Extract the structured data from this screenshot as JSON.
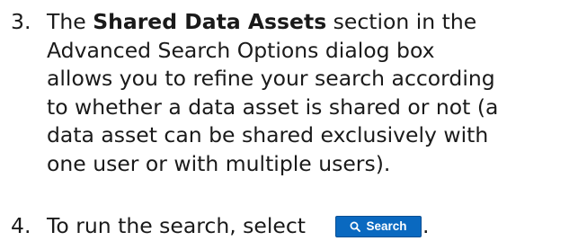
{
  "steps": [
    {
      "number": "3.",
      "intro": "The ",
      "bold": "Shared Data Assets",
      "line1_rest": " section in the",
      "line2": "Advanced Search Options dialog box",
      "line3": "allows you to refine your search according",
      "line4": "to whether a data asset is shared or not (a",
      "line5": "data asset can be shared exclusively with",
      "line6": "one user or with multiple users)."
    },
    {
      "number": "4.",
      "text": "To run the search, select",
      "button_label": "Search",
      "button_icon": "search-icon",
      "suffix": "."
    }
  ],
  "colors": {
    "button_bg": "#0a69c0",
    "button_text": "#ffffff",
    "text": "#1a1a1a"
  }
}
